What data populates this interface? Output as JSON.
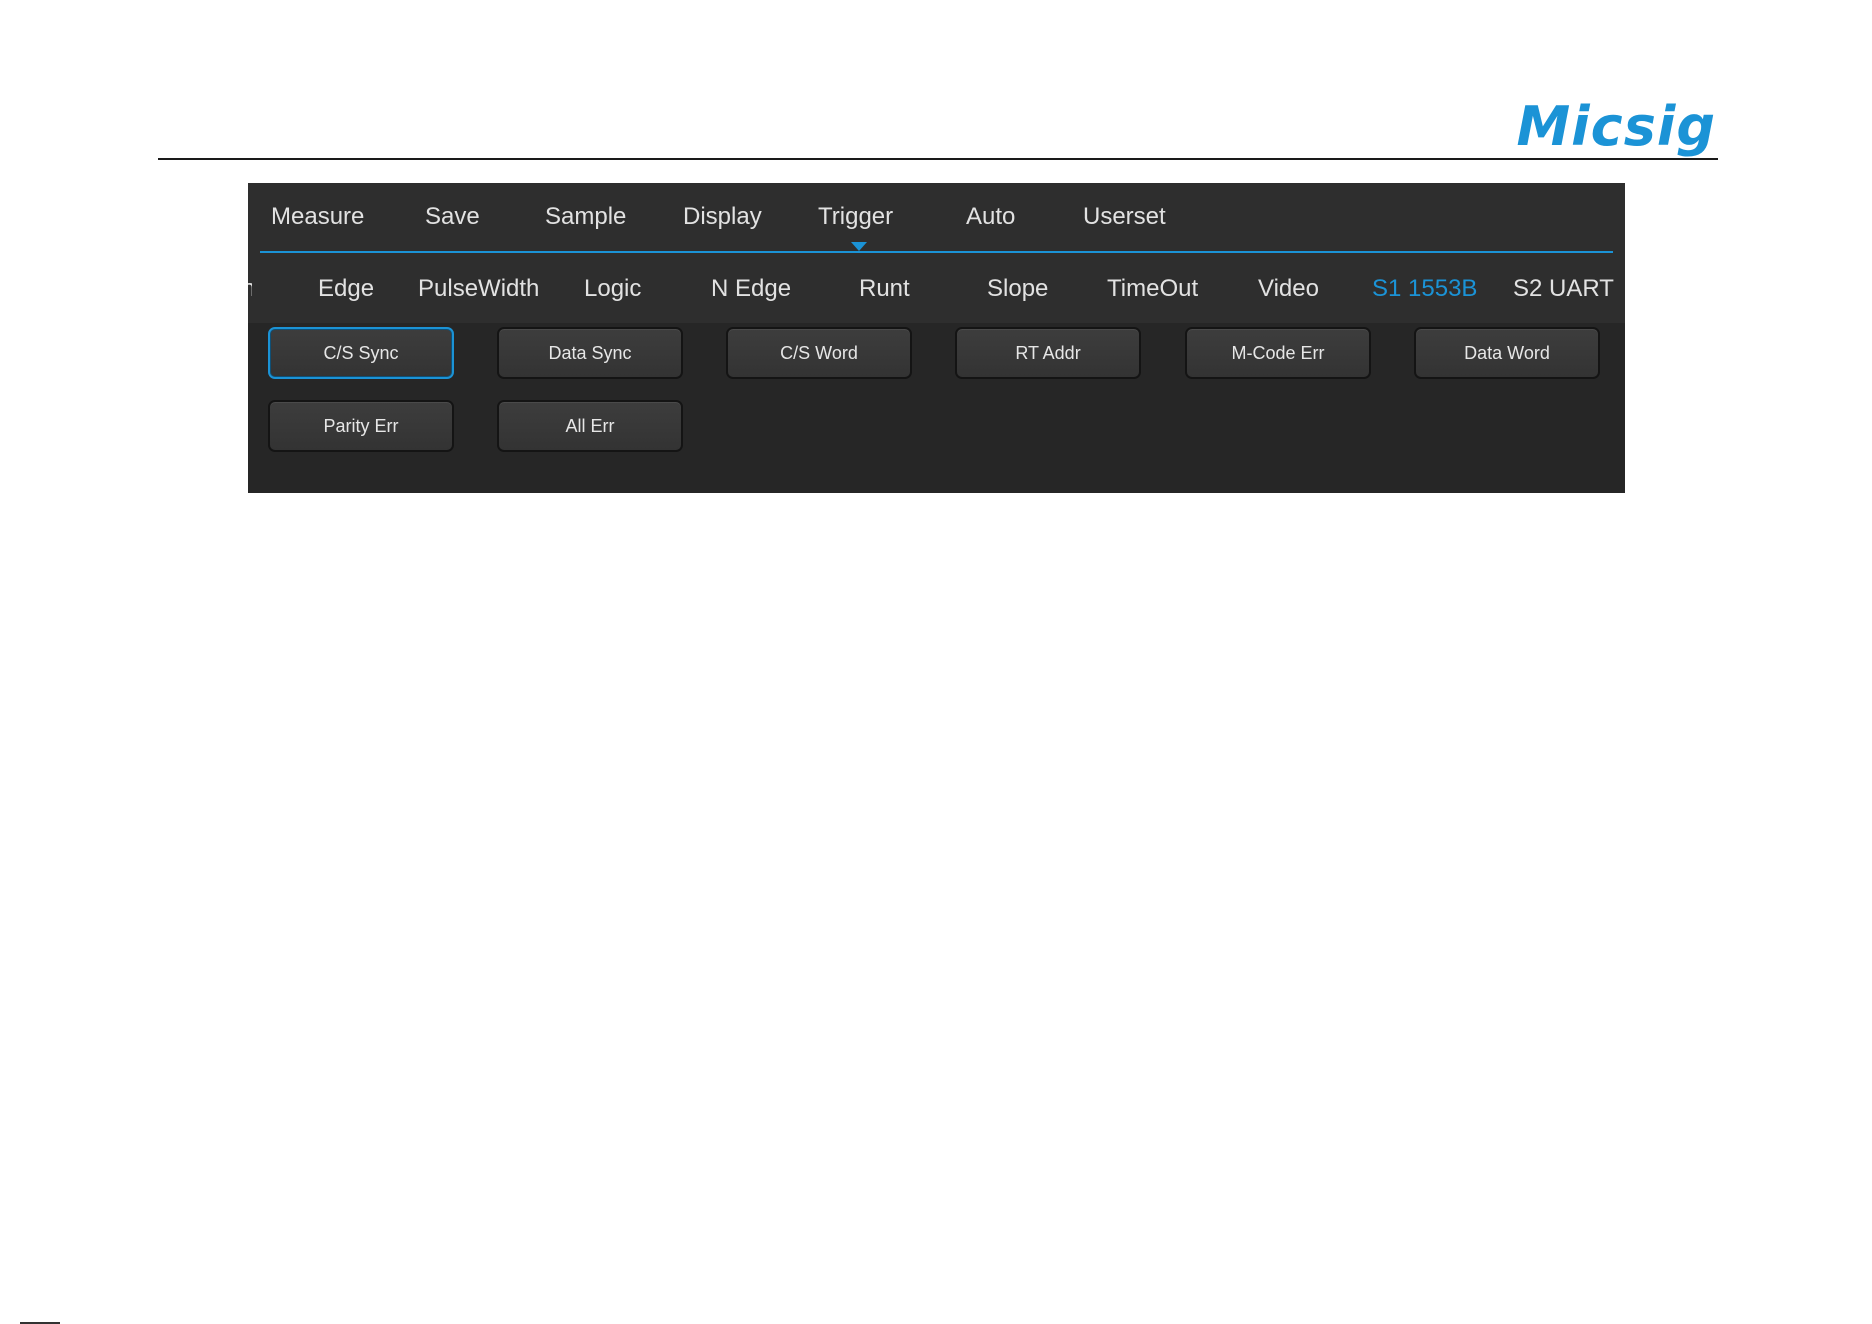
{
  "brand": {
    "logo_text": "Micsig",
    "accent_color": "#1b93d6"
  },
  "menu": {
    "items": [
      {
        "label": "Measure"
      },
      {
        "label": "Save"
      },
      {
        "label": "Sample"
      },
      {
        "label": "Display"
      },
      {
        "label": "Trigger",
        "active": true
      },
      {
        "label": "Auto"
      },
      {
        "label": "Userset"
      }
    ]
  },
  "trigger_types": {
    "clipped_label": "n",
    "items": [
      {
        "label": "Edge"
      },
      {
        "label": "PulseWidth"
      },
      {
        "label": "Logic"
      },
      {
        "label": "N Edge"
      },
      {
        "label": "Runt"
      },
      {
        "label": "Slope"
      },
      {
        "label": "TimeOut"
      },
      {
        "label": "Video"
      },
      {
        "label": "S1 1553B",
        "active": true
      },
      {
        "label": "S2 UART"
      }
    ]
  },
  "conditions": {
    "buttons": [
      {
        "label": "C/S Sync",
        "selected": true
      },
      {
        "label": "Data Sync"
      },
      {
        "label": "C/S Word"
      },
      {
        "label": "RT Addr"
      },
      {
        "label": "M-Code Err"
      },
      {
        "label": "Data Word"
      },
      {
        "label": "Parity Err"
      },
      {
        "label": "All Err"
      }
    ]
  }
}
